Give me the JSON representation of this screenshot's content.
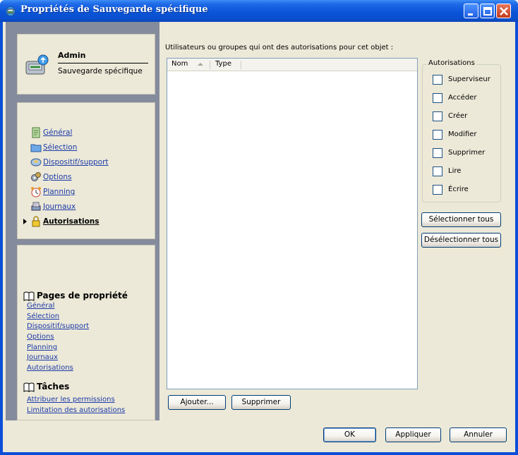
{
  "window": {
    "title": "Propriétés de Sauvegarde spécifique"
  },
  "header_card": {
    "name": "Admin",
    "subtitle": "Sauvegarde spécifique"
  },
  "nav": {
    "items": [
      {
        "label": "Général",
        "icon": "document-icon",
        "active": false
      },
      {
        "label": "Sélection",
        "icon": "folder-icon",
        "active": false
      },
      {
        "label": "Dispositif/support",
        "icon": "drive-icon",
        "active": false
      },
      {
        "label": "Options",
        "icon": "gears-icon",
        "active": false
      },
      {
        "label": "Planning",
        "icon": "alarm-clock-icon",
        "active": false
      },
      {
        "label": "Journaux",
        "icon": "printer-icon",
        "active": false
      },
      {
        "label": "Autorisations",
        "icon": "lock-icon",
        "active": true
      }
    ]
  },
  "property_pages": {
    "heading": "Pages de propriété",
    "links": [
      "Général",
      "Sélection",
      "Dispositif/support",
      "Options",
      "Planning",
      "Journaux",
      "Autorisations"
    ]
  },
  "tasks": {
    "heading": "Tâches",
    "links": [
      "Attribuer les permissions",
      "Limitation des autorisations"
    ]
  },
  "main": {
    "list_caption": "Utilisateurs ou groupes qui ont des autorisations pour cet objet :",
    "columns": [
      "Nom",
      "Type"
    ],
    "rows": [],
    "add_button": "Ajouter...",
    "remove_button": "Supprimer"
  },
  "permissions": {
    "legend": "Autorisations",
    "items": [
      {
        "label": "Superviseur",
        "checked": false
      },
      {
        "label": "Accéder",
        "checked": false
      },
      {
        "label": "Créer",
        "checked": false
      },
      {
        "label": "Modifier",
        "checked": false
      },
      {
        "label": "Supprimer",
        "checked": false
      },
      {
        "label": "Lire",
        "checked": false
      },
      {
        "label": "Écrire",
        "checked": false
      }
    ],
    "select_all": "Sélectionner tous",
    "deselect_all": "Désélectionner tous"
  },
  "footer": {
    "ok": "OK",
    "apply": "Appliquer",
    "cancel": "Annuler"
  },
  "colors": {
    "titlebar": "#0a55d8",
    "face": "#ece9d8",
    "side_panel": "#848b9c",
    "link": "#1c3aa8"
  }
}
